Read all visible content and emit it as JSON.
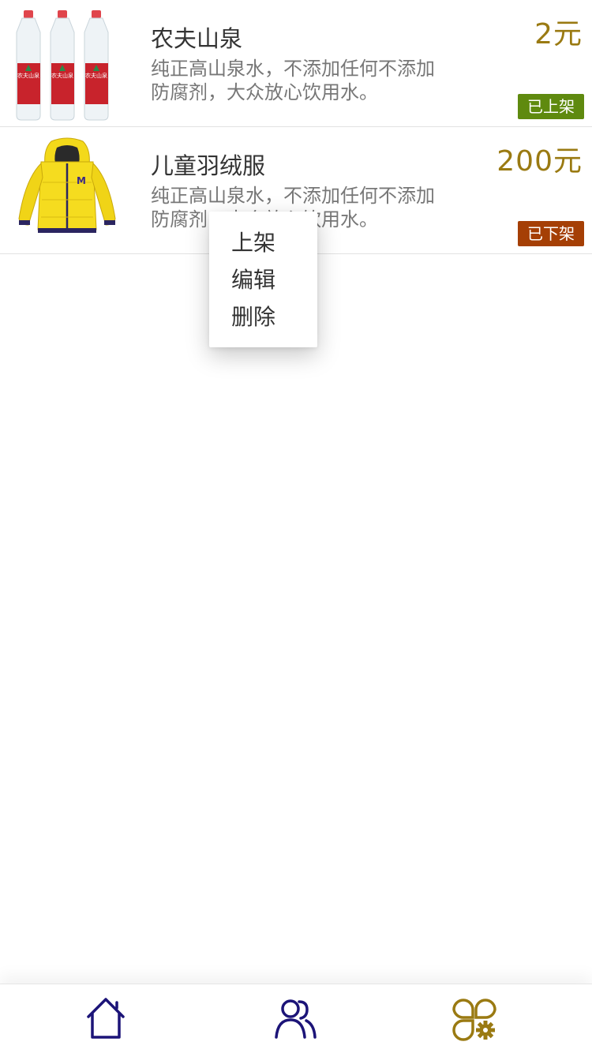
{
  "products": [
    {
      "name": "农夫山泉",
      "desc_line1": "纯正高山泉水，不添加任何不添加",
      "desc_line2": "防腐剂，大众放心饮用水。",
      "price": "2元",
      "status": "已上架",
      "status_color": "#5f8a0f",
      "image": "water-bottles-image",
      "label_text": "农夫山泉"
    },
    {
      "name": "儿童羽绒服",
      "desc_line1": "纯正高山泉水，不添加任何不添加",
      "desc_line2": "防腐剂，大众放心饮用水。",
      "price": "200元",
      "status": "已下架",
      "status_color": "#a53f05",
      "image": "yellow-jacket-image",
      "logo_text": "M"
    }
  ],
  "context_menu": {
    "items": [
      "上架",
      "编辑",
      "删除"
    ]
  },
  "tab_bar": {
    "tabs": [
      {
        "icon": "home-icon",
        "color": "#1c1478"
      },
      {
        "icon": "users-icon",
        "color": "#1c1478"
      },
      {
        "icon": "apps-settings-icon",
        "color": "#9a7a12"
      }
    ]
  },
  "colors": {
    "accent": "#9a7a12",
    "text": "#333333",
    "muted": "#777777"
  }
}
